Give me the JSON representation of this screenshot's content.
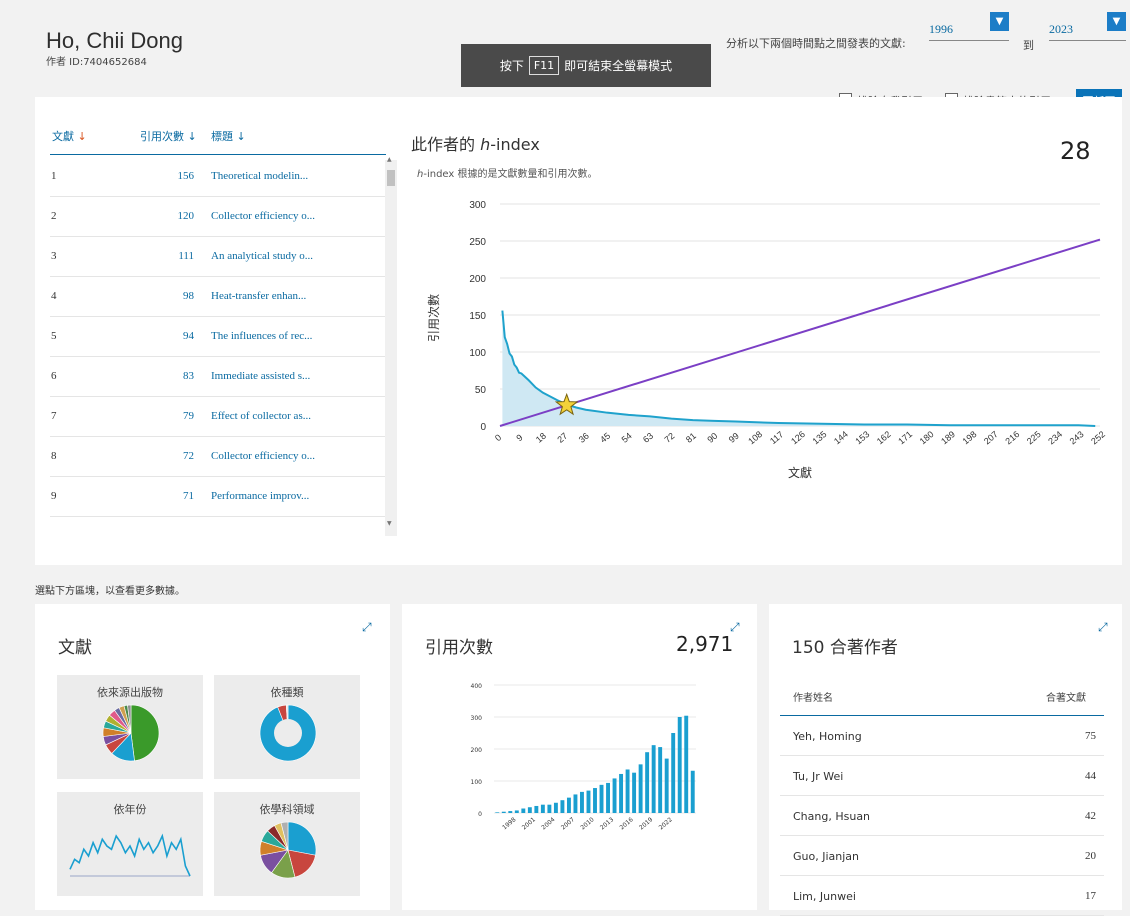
{
  "author": {
    "name": "Ho, Chii Dong",
    "id_label": "作者 ID:7404652684"
  },
  "fullscreen": {
    "press": "按下",
    "key": "F11",
    "suffix": "即可結束全螢幕模式"
  },
  "filter": {
    "range_label": "分析以下兩個時間點之間發表的文獻:",
    "from_year": "1996",
    "to_label": "到",
    "to_year": "2023",
    "exclude_self": "排除自我引用",
    "exclude_books": "排除書籍中的引用",
    "update_button": "更新圖"
  },
  "table": {
    "col_docs": "文獻",
    "col_citations": "引用次數",
    "col_title": "標題",
    "rows": [
      {
        "idx": "1",
        "citations": "156",
        "title": "Theoretical modelin..."
      },
      {
        "idx": "2",
        "citations": "120",
        "title": "Collector efficiency o..."
      },
      {
        "idx": "3",
        "citations": "111",
        "title": "An analytical study o..."
      },
      {
        "idx": "4",
        "citations": "98",
        "title": "Heat-transfer enhan..."
      },
      {
        "idx": "5",
        "citations": "94",
        "title": "The influences of rec..."
      },
      {
        "idx": "6",
        "citations": "83",
        "title": "Immediate assisted s..."
      },
      {
        "idx": "7",
        "citations": "79",
        "title": "Effect of collector as..."
      },
      {
        "idx": "8",
        "citations": "72",
        "title": "Collector efficiency o..."
      },
      {
        "idx": "9",
        "citations": "71",
        "title": "Performance improv..."
      }
    ]
  },
  "hindex": {
    "title_prefix": "此作者的 ",
    "title_h": "h",
    "title_suffix": "-index",
    "sub_h": "h",
    "sub_text": "-index 根據的是文獻數量和引用次數。",
    "value": "28"
  },
  "hint": "選點下方區塊，以查看更多數據。",
  "cards": {
    "docs": {
      "title": "文獻",
      "by_source": "依來源出版物",
      "by_type": "依種類",
      "by_year": "依年份",
      "by_subject": "依學科領域"
    },
    "citations": {
      "title": "引用次數",
      "total": "2,971"
    },
    "coauthors": {
      "title": "150 合著作者",
      "col_name": "作者姓名",
      "col_count": "合著文獻",
      "rows": [
        {
          "name": "Yeh, Homing",
          "count": "75"
        },
        {
          "name": "Tu, Jr Wei",
          "count": "44"
        },
        {
          "name": "Chang, Hsuan",
          "count": "42"
        },
        {
          "name": "Guo, Jianjan",
          "count": "20"
        },
        {
          "name": "Lim, Junwei",
          "count": "17"
        }
      ]
    }
  },
  "colors": {
    "accent": "#0a6aa1",
    "h_line": "#7b3fc5",
    "curve": "#1fa2cc",
    "button": "#0a73b8"
  },
  "chart_data": [
    {
      "type": "area",
      "xlabel": "文獻",
      "ylabel": "引用次數",
      "ylim": [
        0,
        300
      ],
      "xlim": [
        0,
        252
      ],
      "yticks": [
        0,
        50,
        100,
        150,
        200,
        250,
        300
      ],
      "xticks": [
        0,
        9,
        18,
        27,
        36,
        45,
        54,
        63,
        72,
        81,
        90,
        99,
        108,
        117,
        126,
        135,
        144,
        153,
        162,
        171,
        180,
        189,
        198,
        207,
        216,
        225,
        234,
        243,
        252
      ],
      "series": [
        {
          "values": [
            [
              1,
              156
            ],
            [
              2,
              120
            ],
            [
              3,
              111
            ],
            [
              4,
              98
            ],
            [
              5,
              94
            ],
            [
              6,
              83
            ],
            [
              7,
              79
            ],
            [
              8,
              72
            ],
            [
              9,
              71
            ],
            [
              12,
              62
            ],
            [
              15,
              52
            ],
            [
              18,
              45
            ],
            [
              21,
              40
            ],
            [
              24,
              35
            ],
            [
              28,
              29
            ],
            [
              32,
              25
            ],
            [
              36,
              22
            ],
            [
              45,
              18
            ],
            [
              54,
              15
            ],
            [
              63,
              13
            ],
            [
              72,
              10
            ],
            [
              81,
              8
            ],
            [
              90,
              7
            ],
            [
              99,
              6
            ],
            [
              117,
              4
            ],
            [
              135,
              3
            ],
            [
              153,
              2
            ],
            [
              171,
              2
            ],
            [
              189,
              1
            ],
            [
              207,
              1
            ],
            [
              225,
              1
            ],
            [
              243,
              1
            ],
            [
              250,
              0
            ]
          ]
        },
        {
          "values": [
            [
              0,
              0
            ],
            [
              252,
              252
            ]
          ]
        }
      ],
      "marker": {
        "x": 28,
        "y": 28
      }
    },
    {
      "type": "bar",
      "yticks": [
        0,
        100,
        200,
        300,
        400
      ],
      "ylim": [
        0,
        400
      ],
      "tick_labels": [
        "1998",
        "2001",
        "2004",
        "2007",
        "2010",
        "2013",
        "2016",
        "2019",
        "2022"
      ],
      "categories": [
        "1996",
        "1997",
        "1998",
        "1999",
        "2000",
        "2001",
        "2002",
        "2003",
        "2004",
        "2005",
        "2006",
        "2007",
        "2008",
        "2009",
        "2010",
        "2011",
        "2012",
        "2013",
        "2014",
        "2015",
        "2016",
        "2017",
        "2018",
        "2019",
        "2020",
        "2021",
        "2022",
        "2023"
      ],
      "values": [
        2,
        4,
        6,
        8,
        14,
        18,
        22,
        26,
        26,
        32,
        40,
        48,
        58,
        66,
        70,
        78,
        88,
        94,
        108,
        122,
        136,
        126,
        152,
        190,
        212,
        206,
        170,
        250,
        300,
        304,
        132
      ]
    },
    {
      "type": "pie",
      "name": "by_source",
      "values": [
        48,
        14,
        6,
        5,
        5,
        4,
        4,
        4,
        3,
        3,
        2,
        2
      ],
      "colors": [
        "#3a9a2a",
        "#1a9fd0",
        "#c8463e",
        "#7a4fa0",
        "#d0802a",
        "#2aa89a",
        "#b0b030",
        "#e05a8a",
        "#6a6aa0",
        "#d0a050",
        "#4a8a4a",
        "#909090"
      ]
    },
    {
      "type": "pie",
      "name": "by_type",
      "values": [
        94,
        5,
        1
      ],
      "colors": [
        "#1a9fd0",
        "#c8463e",
        "#e0e0e0"
      ]
    },
    {
      "type": "line",
      "name": "by_year",
      "values": [
        2,
        5,
        4,
        8,
        6,
        10,
        7,
        11,
        9,
        8,
        12,
        10,
        7,
        9,
        6,
        11,
        8,
        10,
        7,
        9,
        12,
        6,
        10,
        8,
        11,
        3,
        0
      ]
    },
    {
      "type": "pie",
      "name": "by_subject",
      "values": [
        28,
        18,
        14,
        12,
        8,
        7,
        5,
        4,
        4
      ],
      "colors": [
        "#1a9fd0",
        "#c8463e",
        "#7aa04a",
        "#7a4fa0",
        "#d0802a",
        "#2aa89a",
        "#8a2a2a",
        "#e0c060",
        "#b0b0b0"
      ]
    }
  ]
}
